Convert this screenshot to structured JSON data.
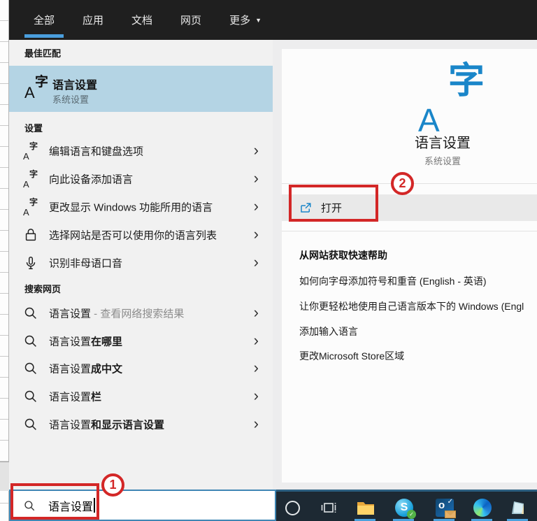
{
  "colors": {
    "accent_blue": "#1a86c9",
    "highlight_blue": "#b4d4e4",
    "annotation_red": "#d32727",
    "taskbar_bg": "#1d2933",
    "tab_underline": "#4a9edd"
  },
  "glyphs": {
    "chevron": "›",
    "dropdown": "▼",
    "check": "✓",
    "lang_a": "A",
    "lang_zi": "字"
  },
  "tabs": {
    "items": [
      {
        "label": "全部",
        "active": true
      },
      {
        "label": "应用",
        "active": false
      },
      {
        "label": "文档",
        "active": false
      },
      {
        "label": "网页",
        "active": false
      },
      {
        "label": "更多",
        "active": false,
        "has_dropdown": true
      }
    ]
  },
  "best_match": {
    "header": "最佳匹配",
    "title": "语言设置",
    "subtitle": "系统设置"
  },
  "settings": {
    "header": "设置",
    "items": [
      {
        "icon": "language-icon",
        "label": "编辑语言和键盘选项"
      },
      {
        "icon": "language-icon",
        "label": "向此设备添加语言"
      },
      {
        "icon": "language-icon",
        "label": "更改显示 Windows 功能所用的语言"
      },
      {
        "icon": "lock-icon",
        "label": "选择网站是否可以使用你的语言列表"
      },
      {
        "icon": "microphone-icon",
        "label": "识别非母语口音"
      }
    ]
  },
  "web_search": {
    "header": "搜索网页",
    "items": [
      {
        "base": "语言设置",
        "bold": "",
        "suffix": " - 查看网络搜索结果"
      },
      {
        "base": "语言设置",
        "bold": "在哪里",
        "suffix": ""
      },
      {
        "base": "语言设置",
        "bold": "成中文",
        "suffix": ""
      },
      {
        "base": "语言设置",
        "bold": "栏",
        "suffix": ""
      },
      {
        "base": "语言设置",
        "bold": "和显示语言设置",
        "suffix": ""
      }
    ]
  },
  "preview": {
    "title": "语言设置",
    "subtitle": "系统设置",
    "open_label": "打开",
    "help_header": "从网站获取快速帮助",
    "help_items": [
      "如何向字母添加符号和重音 (English - 英语)",
      "让你更轻松地使用自己语言版本下的 Windows (Engl",
      "添加输入语言",
      "更改Microsoft Store区域"
    ]
  },
  "annotations": {
    "step1": "1",
    "step2": "2"
  },
  "search_box": {
    "value": "语言设置"
  },
  "taskbar": {
    "skype_letter": "S",
    "outlook_letter": "o",
    "icons": [
      "cortana",
      "task-view",
      "file-explorer",
      "skype",
      "outlook",
      "edge",
      "notepad"
    ]
  }
}
